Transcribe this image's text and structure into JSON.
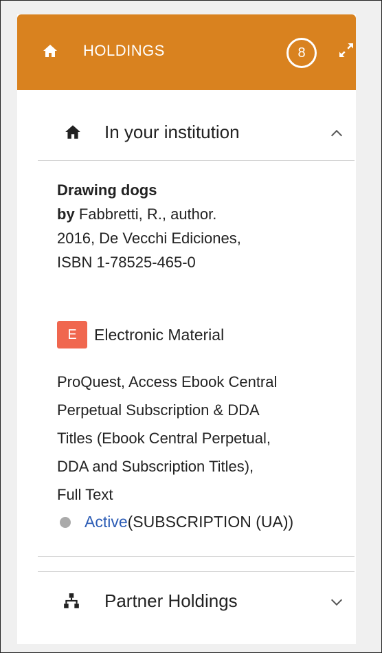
{
  "header": {
    "title": "HOLDINGS",
    "count": "8"
  },
  "institution": {
    "heading": "In your institution",
    "record": {
      "title": "Drawing dogs",
      "by_label": "by",
      "author": "Fabbretti, R., author.",
      "publication": "2016, De Vecchi Ediciones,",
      "isbn": "ISBN 1-78525-465-0"
    },
    "material": {
      "badge": "E",
      "label": "Electronic Material",
      "badge_color": "#f0674f"
    },
    "description_lines": [
      "ProQuest, Access Ebook Central",
      "Perpetual Subscription & DDA",
      "Titles (Ebook Central Perpetual,",
      "DDA and Subscription Titles),",
      "Full Text"
    ],
    "status": {
      "state": "Active",
      "detail": "(SUBSCRIPTION (UA))"
    }
  },
  "partner": {
    "heading": "Partner Holdings"
  },
  "colors": {
    "header_bg": "#d9821f",
    "link": "#2c5cb5"
  }
}
